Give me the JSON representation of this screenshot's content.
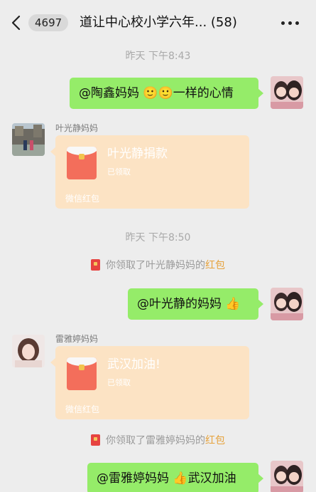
{
  "header": {
    "unread_count": "4697",
    "title": "道让中心校小学六年... (58)"
  },
  "messages": {
    "time1": "昨天 下午8:43",
    "out1": {
      "text": "@陶鑫妈妈 🙂🙂一样的心情"
    },
    "red1": {
      "sender": "叶光静妈妈",
      "title": "叶光静捐款",
      "status": "已领取",
      "footer": "微信红包"
    },
    "time2": "昨天 下午8:50",
    "sys1": {
      "prefix": "你领取了叶光静妈妈的",
      "link": "红包"
    },
    "out2": {
      "text": "@叶光静的妈妈 👍"
    },
    "red2": {
      "sender": "雷雅婷妈妈",
      "title": "武汉加油!",
      "status": "已领取",
      "footer": "微信红包"
    },
    "sys2": {
      "prefix": "你领取了雷雅婷妈妈的",
      "link": "红包"
    },
    "out3": {
      "text": "@雷雅婷妈妈 👍武汉加油"
    }
  },
  "colors": {
    "outgoing_bubble": "#95ec69",
    "red_packet_card": "#fce3c4",
    "red_packet": "#f36e5b",
    "link": "#e6a23c"
  },
  "icons": {
    "back": "chevron-left-icon",
    "more": "more-dots-icon",
    "red_packet": "red-packet-icon"
  }
}
